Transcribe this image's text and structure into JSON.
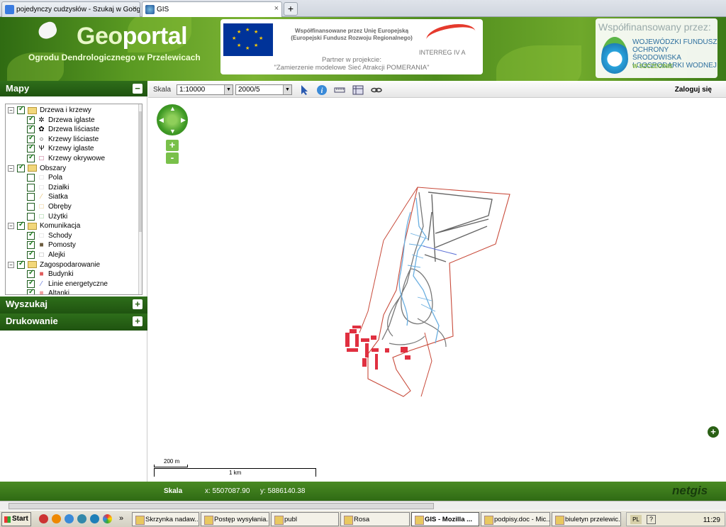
{
  "browser": {
    "tabs": [
      {
        "label": "pojedynczy cudzysłów - Szukaj w Google",
        "close": "×"
      },
      {
        "label": "GIS",
        "close": "×"
      }
    ],
    "new_tab": "+"
  },
  "header": {
    "title_geo": "Geo",
    "title_portal": "portal",
    "subtitle": "Ogrodu Dendrologicznego w Przelewicach",
    "eu_line1": "Współfinansowane przez Unię Europejską",
    "eu_line2": "(Europejski Fundusz Rozwoju Regionalnego)",
    "partner_line1": "Partner w projekcie:",
    "partner_line2": "\"Zamierzenie modelowe Sieć Atrakcji POMERANIA\"",
    "interreg": "INTERREG IV A",
    "cofinanced_by": "Współfinansowany przez:",
    "fund_line1": "WOJEWÓDZKI FUNDUSZ",
    "fund_line2": "OCHRONY ŚRODOWISKA",
    "fund_line3": "I GOSPODARKI WODNEJ",
    "fund_city": "W SZCZECINIE"
  },
  "sidebar": {
    "maps_title": "Mapy",
    "maps_toggle": "−",
    "search_title": "Wyszukaj",
    "search_toggle": "+",
    "print_title": "Drukowanie",
    "print_toggle": "+",
    "tree": [
      {
        "label": "Drzewa i krzewy",
        "group": true,
        "checked": true,
        "symbol": "folder"
      },
      {
        "label": "Drzewa iglaste",
        "checked": true,
        "symbol": "✲"
      },
      {
        "label": "Drzewa liściaste",
        "checked": true,
        "symbol": "✿"
      },
      {
        "label": "Krzewy liściaste",
        "checked": true,
        "symbol": "○"
      },
      {
        "label": "Krzewy iglaste",
        "checked": true,
        "symbol": "Ѱ"
      },
      {
        "label": "Krzewy okrywowe",
        "checked": true,
        "symbol": "□"
      },
      {
        "label": "Obszary",
        "group": true,
        "checked": true,
        "symbol": "folder"
      },
      {
        "label": "Pola",
        "checked": false,
        "symbol": "□"
      },
      {
        "label": "Działki",
        "checked": false,
        "symbol": "□"
      },
      {
        "label": "Siatka",
        "checked": false,
        "symbol": "⁄"
      },
      {
        "label": "Obręby",
        "checked": false,
        "symbol": "□"
      },
      {
        "label": "Użytki",
        "checked": false,
        "symbol": "□"
      },
      {
        "label": "Komunikacja",
        "group": true,
        "checked": true,
        "symbol": "folder"
      },
      {
        "label": "Schody",
        "checked": true,
        "symbol": "□"
      },
      {
        "label": "Pomosty",
        "checked": true,
        "symbol": "■"
      },
      {
        "label": "Alejki",
        "checked": true,
        "symbol": "□"
      },
      {
        "label": "Zagospodarowanie",
        "group": true,
        "checked": true,
        "symbol": "folder"
      },
      {
        "label": "Budynki",
        "checked": true,
        "symbol": "■"
      },
      {
        "label": "Linie energetyczne",
        "checked": true,
        "symbol": "⁄"
      },
      {
        "label": "Altanki",
        "checked": true,
        "symbol": "■"
      }
    ],
    "symbol_colors": {
      "Krzewy okrywowe": "#b03a6a",
      "Pola": "#cccccc",
      "Działki": "#cccccc",
      "Siatka": "#e8c070",
      "Obręby": "#e8c070",
      "Użytki": "#7cc47c",
      "Schody": "#cccccc",
      "Pomosty": "#6b5a3e",
      "Alejki": "#999999",
      "Budynki": "#e05c5c",
      "Linie energetyczne": "#5a6fd6",
      "Altanki": "#f0a0a0"
    }
  },
  "toolbar": {
    "scale_label": "Skala",
    "scale_value": "1:10000",
    "grid_value": "2000/5",
    "login": "Zaloguj się"
  },
  "map": {
    "zoom_in": "+",
    "zoom_out": "-",
    "expand": "+",
    "scale_small": "200 m",
    "scale_large": "1 km"
  },
  "statusbar": {
    "scale_label": "Skala",
    "x": "x: 5507087.90",
    "y": "y: 5886140.38",
    "logo": "netgis"
  },
  "taskbar": {
    "start": "Start",
    "overflow": "»",
    "items": [
      {
        "label": "Skrzynka nadaw..."
      },
      {
        "label": "Postęp wysyłania..."
      },
      {
        "label": "publ"
      },
      {
        "label": "Rosa"
      },
      {
        "label": "GIS - Mozilla ...",
        "active": true
      },
      {
        "label": "podpisy.doc - Mic..."
      },
      {
        "label": "biuletyn przelewic..."
      }
    ],
    "lang": "PL",
    "clock": "11:29"
  },
  "colors": {
    "green_dark": "#2e6e1a",
    "parcel_line": "#c84a3a",
    "path_line": "#666666",
    "water_line": "#6aaee0",
    "building": "#e03040"
  }
}
